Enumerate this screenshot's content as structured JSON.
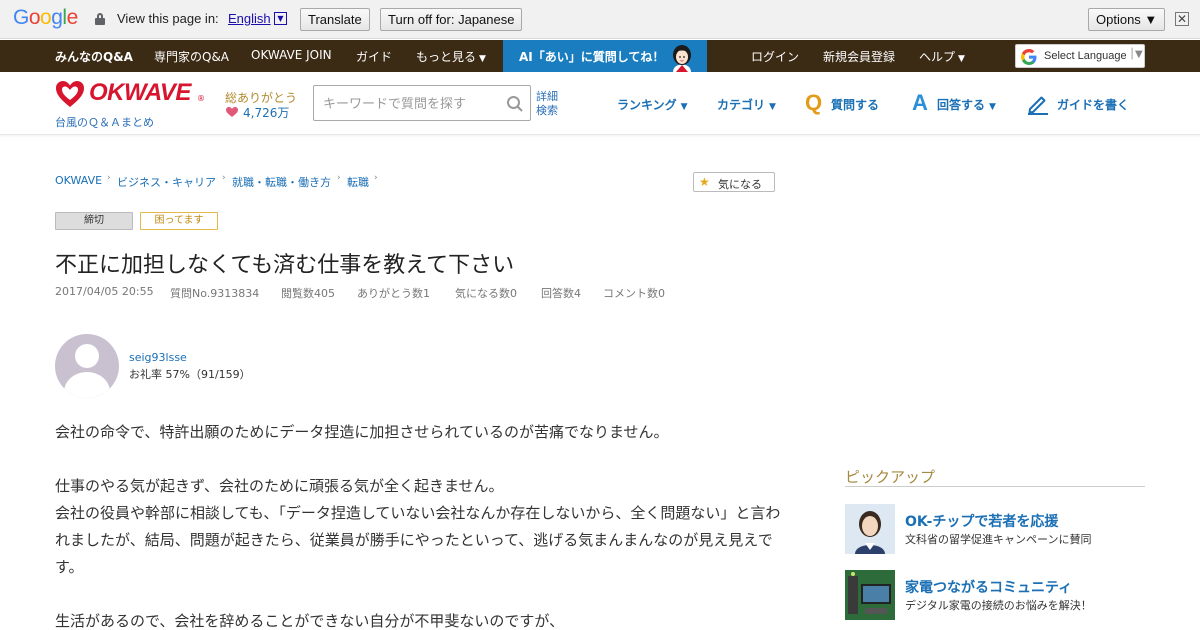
{
  "translate_bar": {
    "view_label": "View this page in:",
    "language": "English",
    "translate_button": "Translate",
    "turn_off_button": "Turn off for: Japanese",
    "options_button": "Options ▼",
    "close": "✕"
  },
  "top_nav": {
    "items": [
      "みんなのQ&A",
      "専門家のQ&A",
      "OKWAVE JOIN",
      "ガイド",
      "もっと見る"
    ],
    "ai_banner": "AI「あい」に質問してね！",
    "right_items": [
      "ログイン",
      "新規会員登録",
      "ヘルプ"
    ],
    "select_language": "Select Language"
  },
  "header": {
    "logo": "OKWAVE",
    "logo_mark": "®",
    "tagline": "台風のＱ＆Ａまとめ",
    "thanks_label": "総ありがとう",
    "thanks_count": "4,726万",
    "search_placeholder": "キーワードで質問を探す",
    "advanced_search": "詳細検索",
    "nav": {
      "ranking": "ランキング",
      "category": "カテゴリ",
      "ask": "質問する",
      "answer": "回答する",
      "guide": "ガイドを書く"
    },
    "q_letter": "Q",
    "a_letter": "A"
  },
  "breadcrumb": [
    "OKWAVE",
    "ビジネス・キャリア",
    "就職・転職・働き方",
    "転職"
  ],
  "watch_button": "気になる",
  "badges": {
    "closed": "締切",
    "trouble": "困ってます"
  },
  "question": {
    "title": "不正に加担しなくても済む仕事を教えて下さい",
    "date": "2017/04/05 20:55",
    "number": "質問No.9313834",
    "views": "閲覧数405",
    "thanks": "ありがとう数1",
    "watch": "気になる数0",
    "answers": "回答数4",
    "comments": "コメント数0",
    "user_name": "seig93lsse",
    "user_rate": "お礼率 57%（91/159）",
    "body": [
      "会社の命令で、特許出願のためにデータ捏造に加担させられているのが苦痛でなりません。",
      "仕事のやる気が起きず、会社のために頑張る気が全く起きません。\n会社の役員や幹部に相談しても、「データ捏造していない会社なんか存在しないから、全く問題ない」と言われましたが、結局、問題が起きたら、従業員が勝手にやったといって、逃げる気まんまんなのが見え見えです。",
      "生活があるので、会社を辞めることができない自分が不甲斐ないのですが、"
    ]
  },
  "pickup": {
    "heading": "ピックアップ",
    "items": [
      {
        "title": "OK-チップで若者を応援",
        "desc": "文科省の留学促進キャンペーンに賛同"
      },
      {
        "title": "家電つながるコミュニティ",
        "desc": "デジタル家電の接続のお悩みを解決！"
      }
    ]
  },
  "colors": {
    "brand_red": "#d7152f",
    "nav_brown": "#3b2a14",
    "link_blue": "#1a6fb5",
    "ai_blue": "#1a7dc0",
    "q_orange": "#e39b1a",
    "a_blue": "#2a8fd6"
  }
}
